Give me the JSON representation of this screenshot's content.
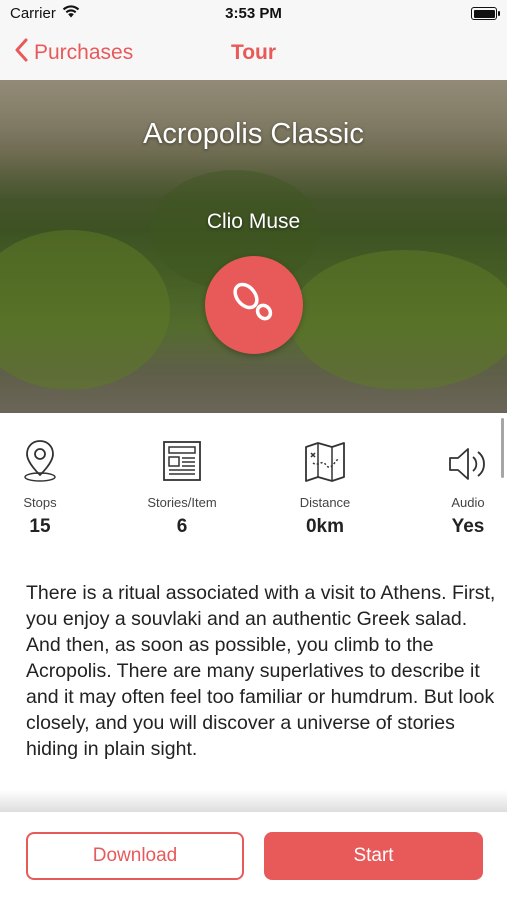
{
  "status_bar": {
    "carrier": "Carrier",
    "time": "3:53 PM"
  },
  "nav": {
    "back_label": "Purchases",
    "title": "Tour"
  },
  "hero": {
    "title": "Acropolis Classic",
    "author": "Clio Muse",
    "badge_icon": "footprints-icon"
  },
  "stats": [
    {
      "label": "Stops",
      "value": "15",
      "icon": "location-pin-icon"
    },
    {
      "label": "Stories/Item",
      "value": "6",
      "icon": "newspaper-icon"
    },
    {
      "label": "Distance",
      "value": "0km",
      "icon": "map-icon"
    },
    {
      "label": "Audio",
      "value": "Yes",
      "icon": "speaker-icon"
    }
  ],
  "description": "There is a ritual associated with a visit to Athens. First, you enjoy a souvlaki and an authentic Greek salad. And then, as soon as possible, you climb to the Acropolis. There are many superlatives to describe it and it may often feel too familiar or humdrum. But look closely, and you will discover a universe of stories hiding in plain sight.",
  "actions": {
    "download_label": "Download",
    "start_label": "Start"
  },
  "colors": {
    "accent": "#e85a5a"
  }
}
